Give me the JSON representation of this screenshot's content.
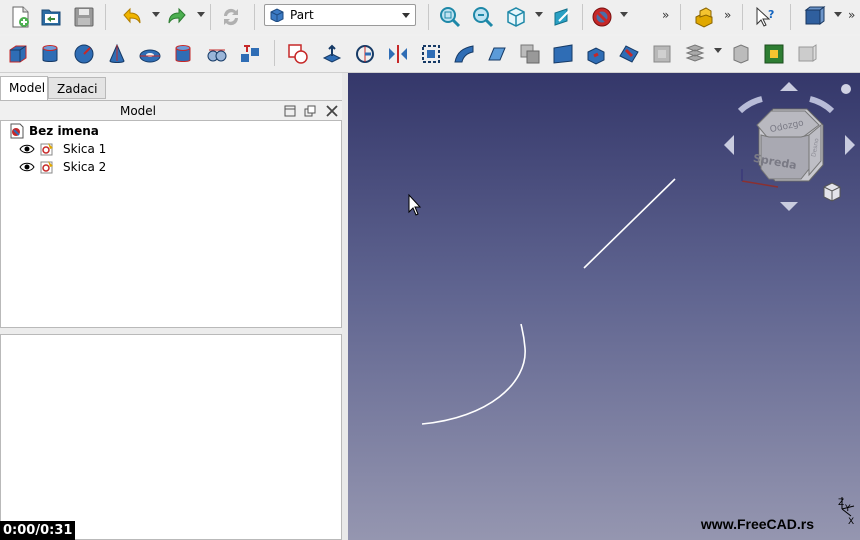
{
  "toolbar1": {
    "workbench": "Part",
    "icons": [
      "new-file-icon",
      "open-file-icon",
      "save-icon",
      "undo-icon",
      "redo-icon",
      "refresh-icon",
      "fit-all-icon",
      "zoom-selection-icon",
      "isometric-view-icon",
      "measure-icon",
      "draw-style-icon",
      "part-design-icon",
      "whats-this-icon",
      "view-box-icon"
    ]
  },
  "toolbar2": {
    "icons": [
      "cube-icon",
      "cylinder-icon",
      "sphere-icon",
      "cone-icon",
      "torus-icon",
      "tube-icon",
      "primitives-icon",
      "shape-builder-icon",
      "boolean-icon",
      "extrude-icon",
      "revolve-icon",
      "mirror-icon",
      "fillet-icon",
      "chamfer-icon",
      "make-face-icon",
      "ruled-surface-icon",
      "loft-icon",
      "sweep-icon",
      "section-icon",
      "cross-sections-icon",
      "compound-icon",
      "check-geometry-icon",
      "thickness-icon",
      "projection-icon"
    ]
  },
  "left_panel": {
    "tabs": [
      "Model",
      "Zadaci"
    ],
    "title": "Model",
    "tree": {
      "root": "Bez imena",
      "children": [
        "Skica 1",
        "Skica 2"
      ]
    }
  },
  "navcube": {
    "faces": [
      "Odozgo",
      "Spreda",
      "Desno"
    ],
    "axes": [
      "Z",
      "Y",
      "X"
    ]
  },
  "viewport": {
    "watermark": "www.FreeCAD.rs",
    "sketch_color": "#ffffff",
    "background_top": "#34376a",
    "background_bottom": "#9596b0"
  },
  "video": {
    "time": "0:00/0:31"
  }
}
